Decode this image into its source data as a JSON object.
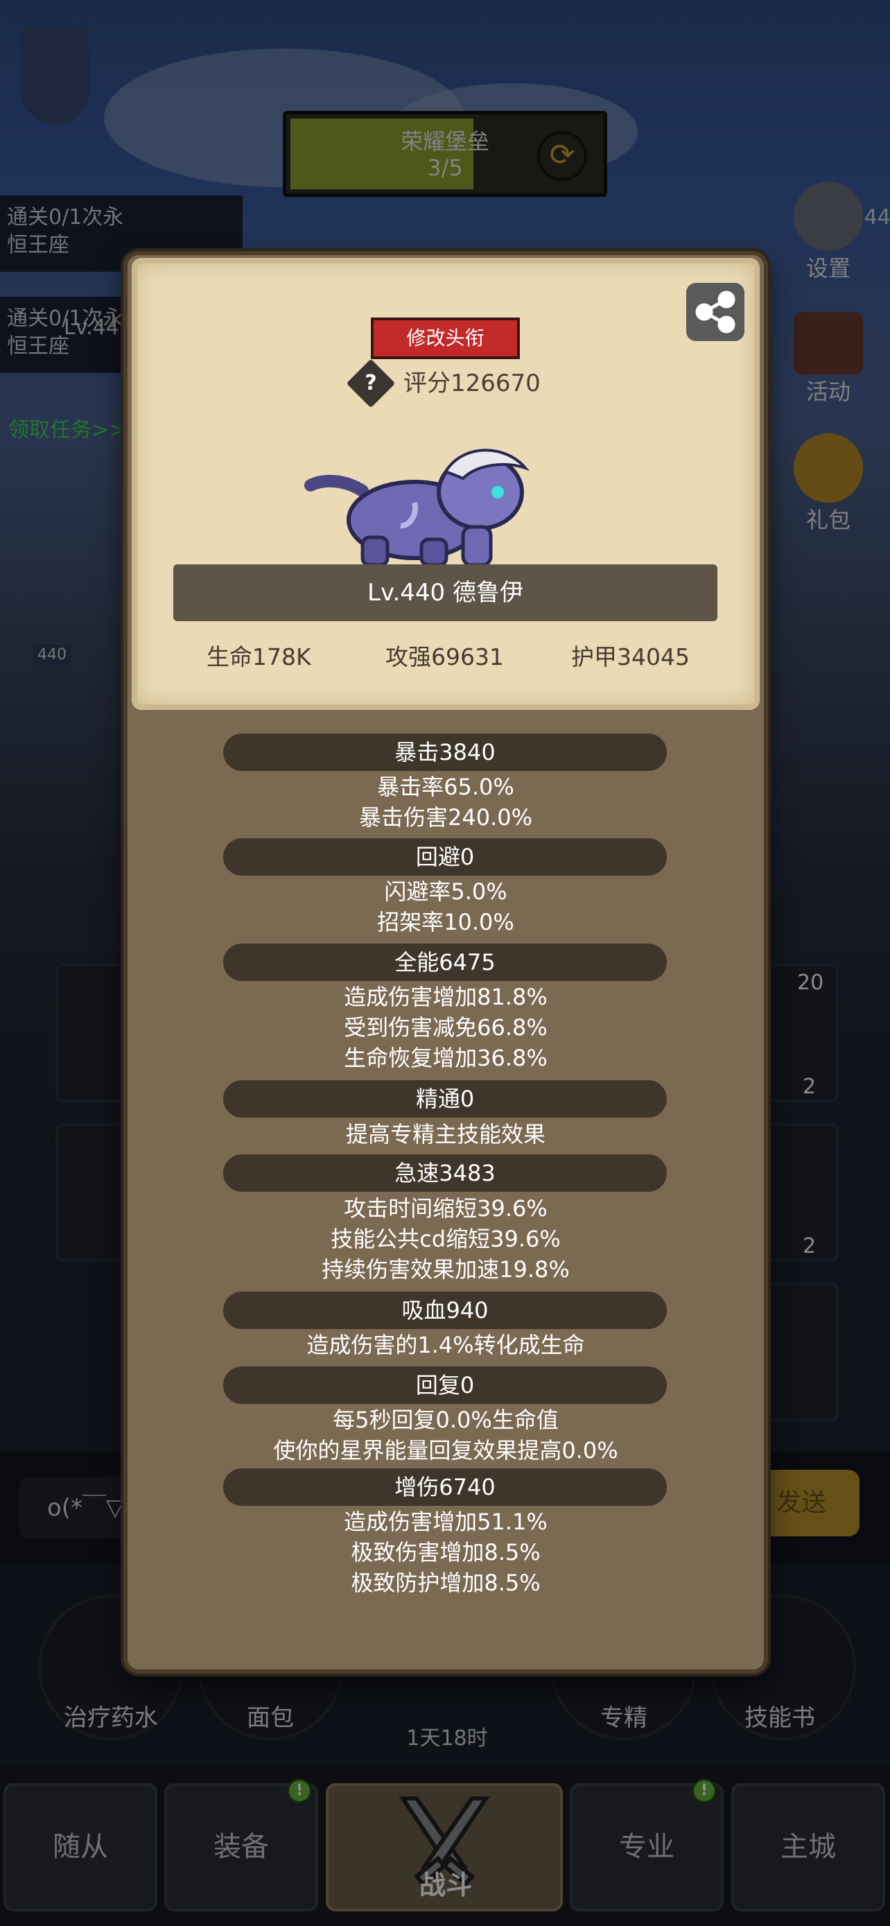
{
  "background": {
    "progress_banner": {
      "title": "荣耀堡垒",
      "count": "3/5"
    },
    "quests": [
      {
        "text_line1": "通关0/1次永",
        "text_line2": "恒王座"
      },
      {
        "text_line1": "通关0/1次永",
        "text_line2": "恒王座"
      }
    ],
    "quest_claim": "领取任务>>",
    "level_tag_1": "Lv.440",
    "level_tag_2": "Lv.44",
    "hp_tag": "440",
    "side_buttons": {
      "settings": "设置",
      "event": "活动",
      "gift": "礼包"
    },
    "slot_counts": [
      "20",
      "2",
      "2"
    ],
    "chat_input": "o(*￣▽",
    "send_label": "发送",
    "items": {
      "potion": "治疗药水",
      "bread": "面包",
      "mastery": "专精",
      "skillbook": "技能书"
    },
    "timer": "1天18时",
    "nav": {
      "followers": "随从",
      "equipment": "装备",
      "battle": "战斗",
      "profession": "专业",
      "main_city": "主城",
      "badge": "!"
    }
  },
  "modal": {
    "title_button": "修改头衔",
    "help_icon": "?",
    "score": "评分126670",
    "hero_name": "Lv.440 德鲁伊",
    "top_stats": {
      "hp": "生命178K",
      "attack": "攻强69631",
      "armor": "护甲34045"
    },
    "sections": [
      {
        "header": "暴击3840",
        "lines": [
          "暴击率65.0%",
          "暴击伤害240.0%"
        ]
      },
      {
        "header": "回避0",
        "lines": [
          "闪避率5.0%",
          "招架率10.0%"
        ]
      },
      {
        "header": "全能6475",
        "lines": [
          "造成伤害增加81.8%",
          "受到伤害减免66.8%",
          "生命恢复增加36.8%"
        ]
      },
      {
        "header": "精通0",
        "lines": [
          "提高专精主技能效果"
        ]
      },
      {
        "header": "急速3483",
        "lines": [
          "攻击时间缩短39.6%",
          "技能公共cd缩短39.6%",
          "持续伤害效果加速19.8%"
        ]
      },
      {
        "header": "吸血940",
        "lines": [
          "造成伤害的1.4%转化成生命"
        ]
      },
      {
        "header": "回复0",
        "lines": [
          "每5秒回复0.0%生命值",
          "使你的星界能量回复效果提高0.0%"
        ]
      },
      {
        "header": "增伤6740",
        "lines": [
          "造成伤害增加51.1%",
          "极致伤害增加8.5%",
          "极致防护增加8.5%"
        ]
      }
    ]
  },
  "colors": {
    "modal_bg": "#7b6a52",
    "card_bg": "#eadbb6",
    "title_button": "#c22a2a",
    "stat_header": "#3f352b",
    "quest_claim": "#3ed45a"
  }
}
